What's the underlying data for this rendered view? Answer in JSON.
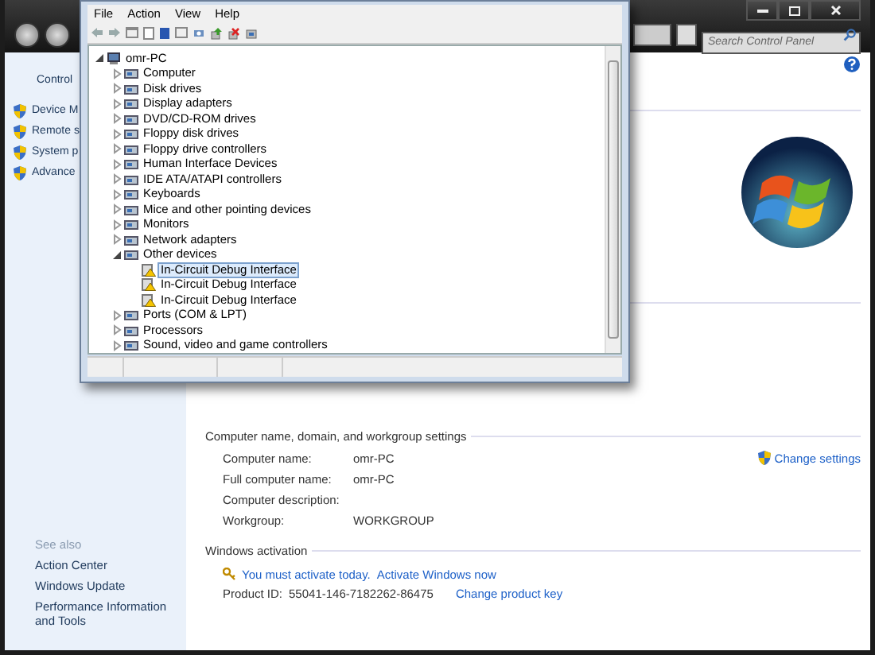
{
  "control_panel": {
    "search": {
      "placeholder": "Search Control Panel"
    },
    "sidebar": {
      "title": "Control",
      "items": [
        "Device M",
        "Remote s",
        "System p",
        "Advance"
      ]
    },
    "see_also": {
      "title": "See also",
      "links": [
        "Action Center",
        "Windows Update",
        "Performance Information and Tools"
      ]
    },
    "computer_name": {
      "heading": "Computer name, domain, and workgroup settings",
      "change_settings": "Change settings",
      "rows": [
        {
          "label": "Computer name:",
          "value": "omr-PC"
        },
        {
          "label": "Full computer name:",
          "value": "omr-PC"
        },
        {
          "label": "Computer description:",
          "value": ""
        },
        {
          "label": "Workgroup:",
          "value": "WORKGROUP"
        }
      ]
    },
    "activation": {
      "heading": "Windows activation",
      "notice": "You must activate today.",
      "activate_link": "Activate Windows now",
      "product_id_label": "Product ID:",
      "product_id": "55041-146-7182262-86475",
      "change_key_link": "Change product key"
    }
  },
  "device_manager": {
    "menu": [
      "File",
      "Action",
      "View",
      "Help"
    ],
    "tree": {
      "label": "omr-PC",
      "kind": "computer",
      "expanded": true,
      "selected": false,
      "children": [
        {
          "label": "Computer",
          "kind": "category",
          "expanded": false,
          "selected": false
        },
        {
          "label": "Disk drives",
          "kind": "category",
          "expanded": false,
          "selected": false
        },
        {
          "label": "Display adapters",
          "kind": "category",
          "expanded": false,
          "selected": false
        },
        {
          "label": "DVD/CD-ROM drives",
          "kind": "category",
          "expanded": false,
          "selected": false
        },
        {
          "label": "Floppy disk drives",
          "kind": "category",
          "expanded": false,
          "selected": false
        },
        {
          "label": "Floppy drive controllers",
          "kind": "category",
          "expanded": false,
          "selected": false
        },
        {
          "label": "Human Interface Devices",
          "kind": "category",
          "expanded": false,
          "selected": false
        },
        {
          "label": "IDE ATA/ATAPI controllers",
          "kind": "category",
          "expanded": false,
          "selected": false
        },
        {
          "label": "Keyboards",
          "kind": "category",
          "expanded": false,
          "selected": false
        },
        {
          "label": "Mice and other pointing devices",
          "kind": "category",
          "expanded": false,
          "selected": false
        },
        {
          "label": "Monitors",
          "kind": "category",
          "expanded": false,
          "selected": false
        },
        {
          "label": "Network adapters",
          "kind": "category",
          "expanded": false,
          "selected": false
        },
        {
          "label": "Other devices",
          "kind": "category",
          "expanded": true,
          "selected": false,
          "children": [
            {
              "label": "In-Circuit Debug Interface",
              "kind": "warning",
              "selected": true
            },
            {
              "label": "In-Circuit Debug Interface",
              "kind": "warning",
              "selected": false
            },
            {
              "label": "In-Circuit Debug Interface",
              "kind": "warning",
              "selected": false
            }
          ]
        },
        {
          "label": "Ports (COM & LPT)",
          "kind": "category",
          "expanded": false,
          "selected": false
        },
        {
          "label": "Processors",
          "kind": "category",
          "expanded": false,
          "selected": false
        },
        {
          "label": "Sound, video and game controllers",
          "kind": "category",
          "expanded": false,
          "selected": false
        }
      ]
    }
  }
}
